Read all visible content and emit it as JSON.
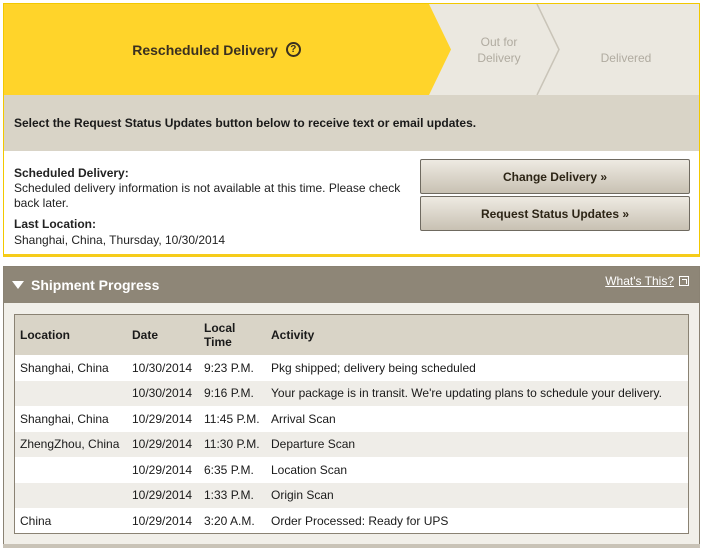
{
  "stepper": {
    "active_step": "Rescheduled Delivery",
    "help_icon": "question-circle-icon",
    "steps": [
      "Out for\nDelivery",
      "Delivered"
    ],
    "colors": {
      "active": "#FFD42A",
      "inactive": "#EBE8E0"
    }
  },
  "instruction": "Select the Request Status Updates button below to receive text or email updates.",
  "scheduled": {
    "title": "Scheduled Delivery:",
    "text": "Scheduled delivery information is not available at this time. Please check back later."
  },
  "last_location": {
    "title": "Last Location:",
    "text": "Shanghai, China, Thursday, 10/30/2014"
  },
  "buttons": {
    "change_delivery": "Change Delivery »",
    "request_updates": "Request Status Updates »"
  },
  "progress": {
    "title": "Shipment Progress",
    "whats_this": "What's This?",
    "columns": [
      "Location",
      "Date",
      "Local Time",
      "Activity"
    ],
    "rows": [
      [
        "Shanghai, China",
        "10/30/2014",
        "9:23 P.M.",
        "Pkg shipped; delivery being scheduled"
      ],
      [
        "",
        "10/30/2014",
        "9:16 P.M.",
        "Your package is in transit. We're updating plans to schedule your delivery."
      ],
      [
        "Shanghai, China",
        "10/29/2014",
        "11:45 P.M.",
        "Arrival Scan"
      ],
      [
        "ZhengZhou, China",
        "10/29/2014",
        "11:30 P.M.",
        "Departure Scan"
      ],
      [
        "",
        "10/29/2014",
        "6:35 P.M.",
        "Location Scan"
      ],
      [
        "",
        "10/29/2014",
        "1:33 P.M.",
        "Origin Scan"
      ],
      [
        "China",
        "10/29/2014",
        "3:20 A.M.",
        "Order Processed: Ready for UPS"
      ]
    ]
  }
}
